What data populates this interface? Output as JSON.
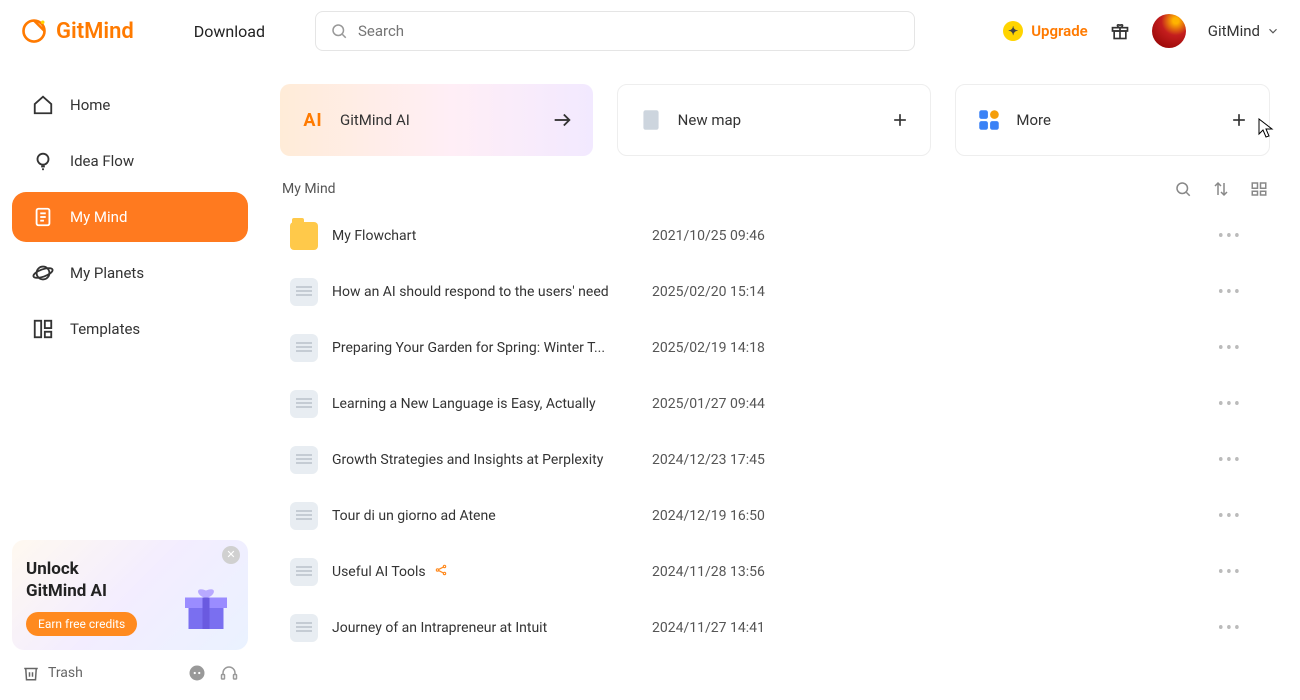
{
  "brand": "GitMind",
  "header": {
    "download": "Download",
    "search_placeholder": "Search",
    "upgrade": "Upgrade",
    "username": "GitMind"
  },
  "sidebar": {
    "items": [
      {
        "label": "Home"
      },
      {
        "label": "Idea Flow"
      },
      {
        "label": "My Mind"
      },
      {
        "label": "My Planets"
      },
      {
        "label": "Templates"
      }
    ],
    "promo": {
      "title_l1": "Unlock",
      "title_l2": "GitMind AI",
      "cta": "Earn free credits"
    },
    "trash": "Trash"
  },
  "cards": {
    "ai": "GitMind AI",
    "newmap": "New map",
    "more": "More"
  },
  "section": {
    "title": "My Mind"
  },
  "files": [
    {
      "type": "folder",
      "name": "My Flowchart",
      "date": "2021/10/25 09:46",
      "shared": false
    },
    {
      "type": "doc",
      "name": "How an AI should respond to the users' need",
      "date": "2025/02/20 15:14",
      "shared": false
    },
    {
      "type": "doc",
      "name": "Preparing Your Garden for Spring: Winter T...",
      "date": "2025/02/19 14:18",
      "shared": false
    },
    {
      "type": "doc",
      "name": "Learning a New Language is Easy, Actually",
      "date": "2025/01/27 09:44",
      "shared": false
    },
    {
      "type": "doc",
      "name": "Growth Strategies and Insights at Perplexity",
      "date": "2024/12/23 17:45",
      "shared": false
    },
    {
      "type": "doc",
      "name": "Tour di un giorno ad Atene",
      "date": "2024/12/19 16:50",
      "shared": false
    },
    {
      "type": "doc",
      "name": "Useful AI Tools",
      "date": "2024/11/28 13:56",
      "shared": true
    },
    {
      "type": "doc",
      "name": "Journey of an Intrapreneur at Intuit",
      "date": "2024/11/27 14:41",
      "shared": false
    }
  ]
}
